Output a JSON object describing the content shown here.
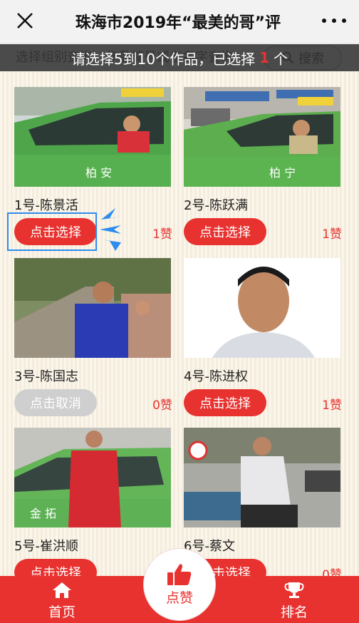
{
  "header": {
    "title": "珠海市2019年“最美的哥”评",
    "close_icon": "close-icon",
    "more_icon": "more-icon"
  },
  "search": {
    "placeholder": "选择组别查询，作品编号或者名字查询",
    "button_label": "搜索"
  },
  "banner": {
    "prefix": "请选择5到10个作品，已选择",
    "count": "1",
    "suffix": "个"
  },
  "cards": [
    {
      "name": "1号-陈景活",
      "button": "点击选择",
      "likes": "1赞",
      "selected": false
    },
    {
      "name": "2号-陈跃满",
      "button": "点击选择",
      "likes": "1赞",
      "selected": false
    },
    {
      "name": "3号-陈国志",
      "button": "点击取消",
      "likes": "0赞",
      "selected": true
    },
    {
      "name": "4号-陈进权",
      "button": "点击选择",
      "likes": "1赞",
      "selected": false
    },
    {
      "name": "5号-崔洪顺",
      "button": "点击选择",
      "likes": "0赞",
      "selected": false
    },
    {
      "name": "6号-蔡文",
      "button": "点击选择",
      "likes": "0赞",
      "selected": false
    }
  ],
  "taxi_texts": {
    "car1": "柏 安",
    "car2": "柏 宁",
    "car5": "金 拓"
  },
  "nav": {
    "home": "首页",
    "like": "点赞",
    "rank": "排名"
  },
  "colors": {
    "accent": "#e8322f",
    "highlight": "#2d8cf0"
  }
}
